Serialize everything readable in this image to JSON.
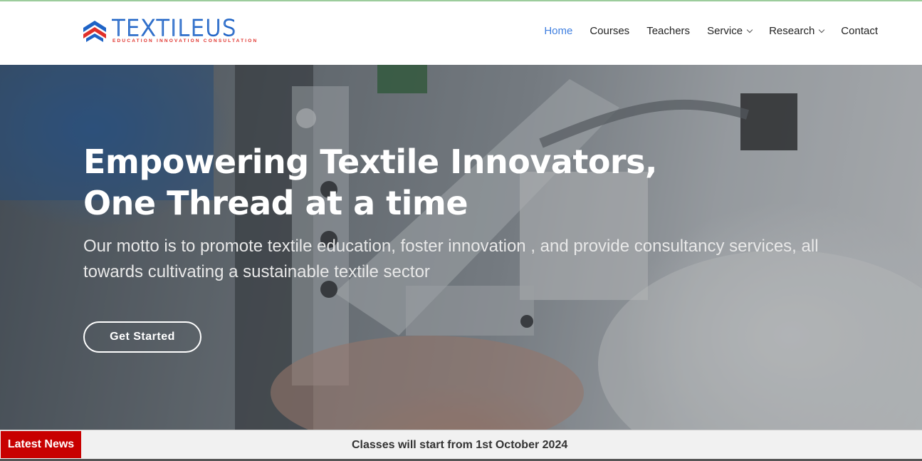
{
  "brand": {
    "name": "TEXTILEUS",
    "tagline": "EDUCATION INNOVATION CONSULTATION",
    "colors": {
      "primary": "#1e63c6",
      "accent": "#e0302a"
    }
  },
  "nav": {
    "items": [
      {
        "label": "Home",
        "active": true,
        "dropdown": false
      },
      {
        "label": "Courses",
        "active": false,
        "dropdown": false
      },
      {
        "label": "Teachers",
        "active": false,
        "dropdown": false
      },
      {
        "label": "Service",
        "active": false,
        "dropdown": true
      },
      {
        "label": "Research",
        "active": false,
        "dropdown": true
      },
      {
        "label": "Contact",
        "active": false,
        "dropdown": false
      }
    ],
    "active_color": "#3f7fe0"
  },
  "hero": {
    "title_line1": "Empowering Textile Innovators,",
    "title_line2": "One Thread at a time",
    "subtitle": "Our motto is to promote textile education, foster innovation , and provide consultancy services, all towards cultivating a sustainable textile sector",
    "cta_label": "Get Started"
  },
  "news": {
    "label": "Latest News",
    "text": "Classes will start from 1st October 2024",
    "label_color": "#c80000"
  }
}
